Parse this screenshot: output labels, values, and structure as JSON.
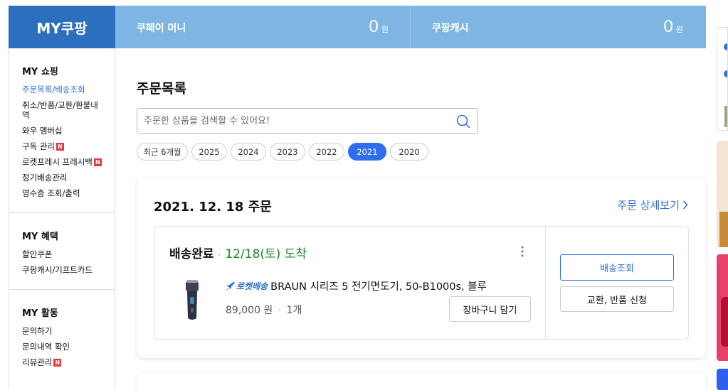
{
  "header": {
    "title": "MY쿠팡",
    "balances": [
      {
        "label": "쿠페이 머니",
        "amount": "0",
        "unit": "원"
      },
      {
        "label": "쿠팡캐시",
        "amount": "0",
        "unit": "원"
      }
    ]
  },
  "sidebar": {
    "sections": [
      {
        "title": "MY 쇼핑",
        "items": [
          {
            "label": "주문목록/배송조회",
            "active": true,
            "new": false
          },
          {
            "label": "취소/반품/교환/환불내역",
            "active": false,
            "new": false
          },
          {
            "label": "와우 멤버십",
            "active": false,
            "new": false
          },
          {
            "label": "구독 관리",
            "active": false,
            "new": true
          },
          {
            "label": "로켓프레시 프레시백",
            "active": false,
            "new": true
          },
          {
            "label": "정기배송관리",
            "active": false,
            "new": false
          },
          {
            "label": "영수증 조회/출력",
            "active": false,
            "new": false
          }
        ]
      },
      {
        "title": "MY 혜택",
        "items": [
          {
            "label": "할인쿠폰",
            "active": false,
            "new": false
          },
          {
            "label": "쿠팡캐시/기프트카드",
            "active": false,
            "new": false
          }
        ]
      },
      {
        "title": "MY 활동",
        "items": [
          {
            "label": "문의하기",
            "active": false,
            "new": false
          },
          {
            "label": "문의내역 확인",
            "active": false,
            "new": false
          },
          {
            "label": "리뷰관리",
            "active": false,
            "new": true
          }
        ]
      }
    ],
    "new_badge": "N"
  },
  "main": {
    "title": "주문목록",
    "search": {
      "placeholder": "주문한 상품을 검색할 수 있어요!",
      "value": ""
    },
    "year_tabs": [
      {
        "label": "최근 6개월",
        "active": false
      },
      {
        "label": "2025",
        "active": false
      },
      {
        "label": "2024",
        "active": false
      },
      {
        "label": "2023",
        "active": false
      },
      {
        "label": "2022",
        "active": false
      },
      {
        "label": "2021",
        "active": true
      },
      {
        "label": "2020",
        "active": false
      }
    ],
    "order": {
      "date_label": "2021. 12. 18 주문",
      "detail_link": "주문 상세보기",
      "status": "배송완료",
      "arrival": "12/18(토) 도착",
      "rocket_label": "로켓배송",
      "product_name": "BRAUN 시리즈 5 전기면도기, 50-B1000s, 블루",
      "price": "89,000 원",
      "quantity": "1개",
      "cart_button": "장바구니 담기",
      "track_button": "배송조회",
      "return_button": "교환, 반품 신청"
    }
  },
  "colors": {
    "brand_blue": "#2c6fbf",
    "balance_bar": "#7fb5e3",
    "link_blue": "#2f6fd9",
    "active_tab": "#2f6fef",
    "arrival_green": "#1a8a2a",
    "new_badge_red": "#e5393c"
  }
}
